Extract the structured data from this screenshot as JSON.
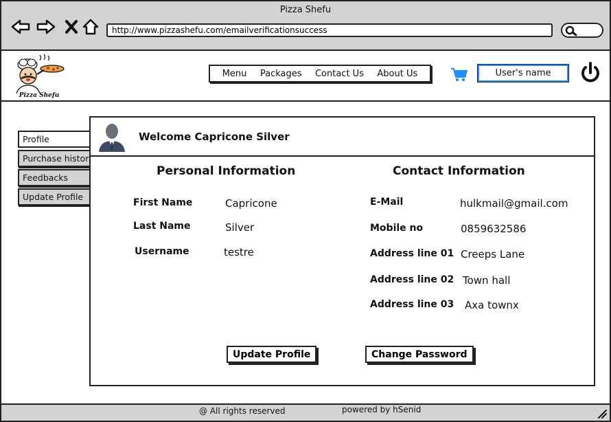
{
  "window": {
    "title": "Pizza Shefu"
  },
  "browser": {
    "url": "http://www.pizzashefu.com/emailverificationsuccess"
  },
  "header": {
    "logo_text": "Pizza Shefu",
    "nav": [
      "Menu",
      "Packages",
      "Contact Us",
      "About Us"
    ],
    "user_name": "User's name"
  },
  "sidebar": {
    "items": [
      {
        "label": "Profile",
        "active": true
      },
      {
        "label": "Purchase history",
        "active": false
      },
      {
        "label": "Feedbacks",
        "active": false
      },
      {
        "label": "Update Profile",
        "active": false
      }
    ]
  },
  "profile": {
    "welcome": "Welcome Capricone Silver",
    "personal": {
      "title": "Personal Information",
      "fields": [
        {
          "label": "First Name",
          "value": "Capricone"
        },
        {
          "label": "Last Name",
          "value": "Silver"
        },
        {
          "label": "Username",
          "value": "testre"
        }
      ]
    },
    "contact": {
      "title": "Contact Information",
      "fields": [
        {
          "label": "E-Mail",
          "value": "hulkmail@gmail.com"
        },
        {
          "label": "Mobile no",
          "value": "0859632586"
        },
        {
          "label": "Address line 01",
          "value": "Creeps Lane"
        },
        {
          "label": "Address line 02",
          "value": "Town hall"
        },
        {
          "label": "Address line 03",
          "value": "Axa townx"
        }
      ]
    },
    "buttons": {
      "update_profile": "Update Profile",
      "change_password": "Change Password"
    }
  },
  "footer": {
    "rights": "@ All rights reserved",
    "powered": "powered by hSenid"
  },
  "colors": {
    "chrome": "#d3d3d3",
    "accent": "#1e90ff",
    "border": "#222222"
  }
}
